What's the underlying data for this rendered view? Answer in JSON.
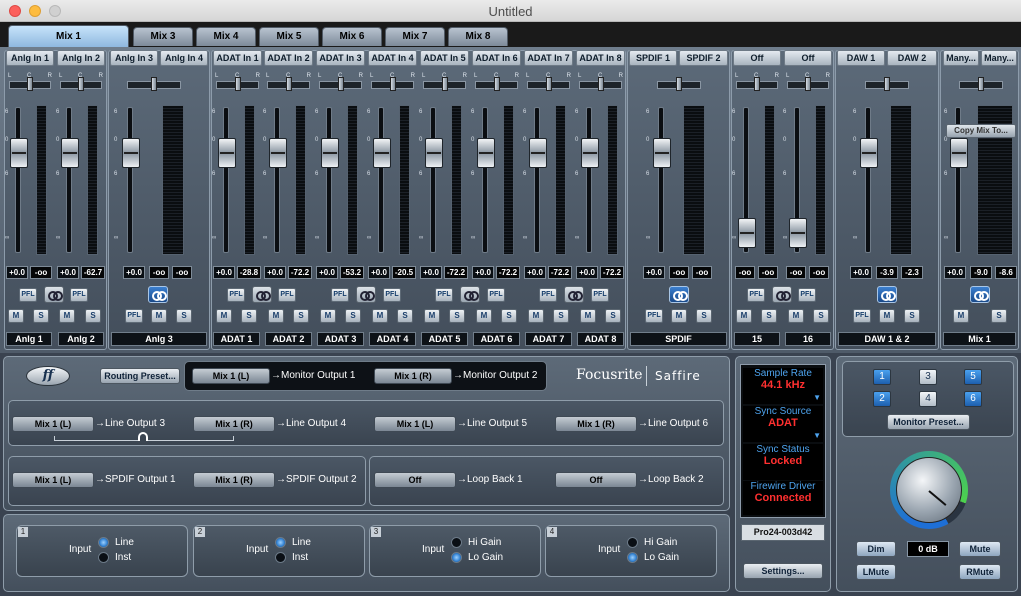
{
  "window": {
    "title": "Untitled"
  },
  "tabs": [
    "Mix 1",
    "Mix 3",
    "Mix 4",
    "Mix 5",
    "Mix 6",
    "Mix 7",
    "Mix 8"
  ],
  "active_tab": "Mix 1",
  "channel_labels": [
    "Anlg In 1",
    "Anlg In 2",
    "Anlg In 3",
    "Anlg In 4",
    "ADAT In 1",
    "ADAT In 2",
    "ADAT In 3",
    "ADAT In 4",
    "ADAT In 5",
    "ADAT In 6",
    "ADAT In 7",
    "ADAT In 8",
    "SPDIF 1",
    "SPDIF 2",
    "Off",
    "Off",
    "DAW 1",
    "DAW 2",
    "Many...",
    "Many..."
  ],
  "pan_marks": {
    "left": "L",
    "center": "C",
    "right": "R"
  },
  "fader_scale": [
    "6",
    "0",
    "6",
    "∞"
  ],
  "values": {
    "anlg1": [
      "+0.0",
      "-oo"
    ],
    "anlg2": [
      "+0.0",
      "-62.7"
    ],
    "anlg34": [
      "+0.0",
      "-oo",
      "-oo"
    ],
    "adat1": [
      "+0.0",
      "-28.8"
    ],
    "adat2": [
      "+0.0",
      "-72.2"
    ],
    "adat3": [
      "+0.0",
      "-53.2"
    ],
    "adat4": [
      "+0.0",
      "-20.5"
    ],
    "adat5": [
      "+0.0",
      "-72.2"
    ],
    "adat6": [
      "+0.0",
      "-72.2"
    ],
    "adat7": [
      "+0.0",
      "-72.2"
    ],
    "adat8": [
      "+0.0",
      "-72.2"
    ],
    "spdif": [
      "+0.0",
      "-oo",
      "-oo"
    ],
    "off15": [
      "-oo",
      "-oo"
    ],
    "off16": [
      "-oo",
      "-oo"
    ],
    "daw": [
      "+0.0",
      "-3.9",
      "-2.3"
    ],
    "mix1": [
      "+0.0",
      "-9.0",
      "-8.6"
    ]
  },
  "buttons": {
    "pfl": "PFL",
    "mute": "M",
    "solo": "S",
    "copy_mix": "Copy Mix To..."
  },
  "strip_names": [
    "Anlg 1",
    "Anlg 2",
    "Anlg 3",
    "ADAT 1",
    "ADAT 2",
    "ADAT 3",
    "ADAT 4",
    "ADAT 5",
    "ADAT 6",
    "ADAT 7",
    "ADAT 8",
    "SPDIF",
    "15",
    "16",
    "DAW 1 & 2",
    "Mix 1"
  ],
  "routing": {
    "preset_button": "Routing Preset...",
    "rows": [
      [
        {
          "src": "Mix 1 (L)",
          "dst": "→Monitor Output 1"
        },
        {
          "src": "Mix 1 (R)",
          "dst": "→Monitor Output 2"
        }
      ],
      [
        {
          "src": "Mix 1 (L)",
          "dst": "→Line Output 3"
        },
        {
          "src": "Mix 1 (R)",
          "dst": "→Line Output 4"
        },
        {
          "src": "Mix 1 (L)",
          "dst": "→Line Output 5"
        },
        {
          "src": "Mix 1 (R)",
          "dst": "→Line Output 6"
        }
      ],
      [
        {
          "src": "Mix 1 (L)",
          "dst": "→SPDIF Output 1"
        },
        {
          "src": "Mix 1 (R)",
          "dst": "→SPDIF Output 2"
        },
        {
          "src": "Off",
          "dst": "→Loop Back 1"
        },
        {
          "src": "Off",
          "dst": "→Loop Back 2"
        }
      ]
    ]
  },
  "brand": {
    "name": "Focusrite",
    "product": "Saffire"
  },
  "status": {
    "sample_rate_label": "Sample Rate",
    "sample_rate": "44.1 kHz",
    "sync_source_label": "Sync Source",
    "sync_source": "ADAT",
    "sync_status_label": "Sync Status",
    "sync_status": "Locked",
    "firewire_label": "Firewire Driver",
    "firewire": "Connected",
    "device": "Pro24-003d42",
    "settings": "Settings..."
  },
  "monitor": {
    "numbers": [
      "1",
      "3",
      "5",
      "2",
      "4",
      "6"
    ],
    "preset_button": "Monitor Preset...",
    "dim": "Dim",
    "level": "0 dB",
    "mute": "Mute",
    "lmute": "LMute",
    "rmute": "RMute"
  },
  "inputs": [
    {
      "num": "1",
      "label": "Input",
      "opt1": "Line",
      "opt2": "Inst"
    },
    {
      "num": "2",
      "label": "Input",
      "opt1": "Line",
      "opt2": "Inst"
    },
    {
      "num": "3",
      "label": "Input",
      "opt1": "Hi Gain",
      "opt2": "Lo Gain"
    },
    {
      "num": "4",
      "label": "Input",
      "opt1": "Hi Gain",
      "opt2": "Lo Gain"
    }
  ]
}
